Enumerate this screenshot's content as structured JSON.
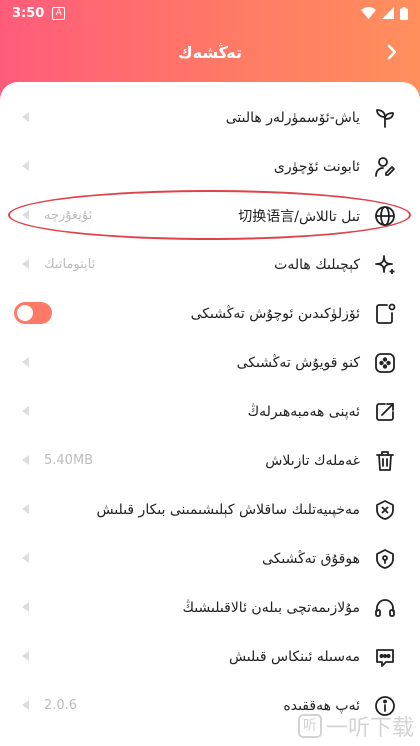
{
  "status_bar": {
    "time": "3:50",
    "notif_letter": "A"
  },
  "header": {
    "title": "تەڭشەك"
  },
  "rows": [
    {
      "label": "ياش-ئۆسمۈرلەر ھالىتى",
      "value": "",
      "icon": "sprout-icon"
    },
    {
      "label": "ئابونت ئۆچۈرى",
      "value": "",
      "icon": "user-edit-icon"
    },
    {
      "label": "تىل تاللاش/切换语言",
      "value": "ئۇيغۇرچە",
      "icon": "globe-icon"
    },
    {
      "label": "كېچىلىك ھالەت",
      "value": "ئاپتوماتىك",
      "icon": "sparkle-icon"
    },
    {
      "label": "ئۆزلۈكىدىن ئوچۇش تەڭشىكى",
      "value": "",
      "icon": "phone-dot-icon",
      "toggle": true
    },
    {
      "label": "كنو قويۇش تەڭشىكى",
      "value": "",
      "icon": "film-reel-icon"
    },
    {
      "label": "ئەپنى ھەمبەھىرلەڭ",
      "value": "",
      "icon": "share-icon"
    },
    {
      "label": "غەملەك تازىلاش",
      "value": "5.40MB",
      "icon": "trash-icon"
    },
    {
      "label": "مەخپىيەتلىك ساقلاش كېلىشىمىنى بىكار قىلىش",
      "value": "",
      "icon": "shield-x-icon"
    },
    {
      "label": "ھوقۇق تەڭشىكى",
      "value": "",
      "icon": "shield-key-icon"
    },
    {
      "label": "مۇلازىمەتچى بىلەن ئالاقىلىشىڭ",
      "value": "",
      "icon": "headset-icon"
    },
    {
      "label": "مەسىلە ئىنكاس قىلىش",
      "value": "",
      "icon": "feedback-icon"
    },
    {
      "label": "ئەپ ھەققىدە",
      "value": "2.0.6",
      "icon": "info-icon"
    }
  ],
  "watermark": {
    "logo_char": "听",
    "text": "一听下载"
  }
}
